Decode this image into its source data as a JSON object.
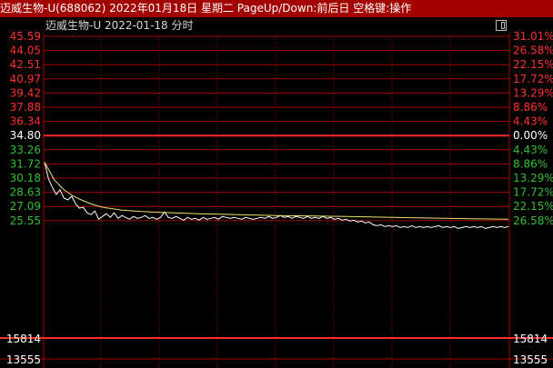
{
  "title_bar": {
    "text": "迈威生物-U(688062) 2022年01月18日 星期二 PageUp/Down:前后日 空格键:操作"
  },
  "chart_header": {
    "text": "迈威生物-U  2022-01-18 分时"
  },
  "colors": {
    "background": "#000000",
    "grid": "#a30000",
    "baseline": "#ff2a2a",
    "up_text": "#ff3030",
    "down_text": "#30c030",
    "neutral_text": "#ffffff",
    "price_line": "#ffffff",
    "avg_line": "#f0e070",
    "title_bar": "#a30000"
  },
  "icons": {
    "maximize": "maximize-icon"
  },
  "chart_data": {
    "type": "line",
    "title": "迈威生物-U  2022-01-18 分时",
    "prev_close": 34.8,
    "ylim": [
      25.55,
      45.59
    ],
    "y_ticks_left": [
      "45.59",
      "44.05",
      "42.51",
      "40.97",
      "39.42",
      "37.88",
      "36.34",
      "34.80",
      "33.26",
      "31.72",
      "30.18",
      "28.63",
      "27.09",
      "25.55"
    ],
    "y_ticks_right": [
      "31.01%",
      "26.58%",
      "22.15%",
      "17.72%",
      "13.29%",
      "8.86%",
      "4.43%",
      "0.00%",
      "4.43%",
      "8.86%",
      "13.29%",
      "17.72%",
      "22.15%",
      "26.58%"
    ],
    "volume_ticks_left": [
      "15814",
      "13555"
    ],
    "volume_ticks_right": [
      "15814",
      "13555"
    ],
    "grid": true,
    "x_minutes": 240,
    "series": [
      {
        "kind": "price",
        "points": [
          [
            0,
            31.9
          ],
          [
            2,
            30.1
          ],
          [
            4,
            29.2
          ],
          [
            6,
            28.4
          ],
          [
            8,
            28.9
          ],
          [
            10,
            28.0
          ],
          [
            12,
            27.8
          ],
          [
            14,
            28.2
          ],
          [
            16,
            27.4
          ],
          [
            18,
            26.9
          ],
          [
            20,
            27.0
          ],
          [
            22,
            26.4
          ],
          [
            24,
            26.2
          ],
          [
            26,
            26.6
          ],
          [
            28,
            25.7
          ],
          [
            30,
            26.0
          ],
          [
            32,
            26.3
          ],
          [
            34,
            25.9
          ],
          [
            36,
            26.4
          ],
          [
            38,
            25.8
          ],
          [
            40,
            26.1
          ],
          [
            42,
            25.9
          ],
          [
            44,
            25.7
          ],
          [
            46,
            26.0
          ],
          [
            48,
            25.8
          ],
          [
            50,
            25.9
          ],
          [
            52,
            26.1
          ],
          [
            54,
            25.8
          ],
          [
            56,
            25.9
          ],
          [
            58,
            25.7
          ],
          [
            60,
            25.9
          ],
          [
            62,
            26.5
          ],
          [
            64,
            25.9
          ],
          [
            66,
            25.8
          ],
          [
            68,
            26.0
          ],
          [
            70,
            25.8
          ],
          [
            72,
            25.6
          ],
          [
            74,
            25.9
          ],
          [
            76,
            25.7
          ],
          [
            78,
            25.8
          ],
          [
            80,
            25.6
          ],
          [
            82,
            25.9
          ],
          [
            84,
            25.7
          ],
          [
            86,
            25.8
          ],
          [
            88,
            25.9
          ],
          [
            90,
            25.7
          ],
          [
            92,
            26.0
          ],
          [
            94,
            25.9
          ],
          [
            96,
            25.8
          ],
          [
            98,
            25.9
          ],
          [
            100,
            25.8
          ],
          [
            102,
            25.7
          ],
          [
            104,
            25.9
          ],
          [
            106,
            25.8
          ],
          [
            108,
            25.7
          ],
          [
            110,
            25.8
          ],
          [
            112,
            25.9
          ],
          [
            114,
            25.8
          ],
          [
            116,
            26.0
          ],
          [
            118,
            25.8
          ],
          [
            120,
            25.9
          ],
          [
            122,
            26.1
          ],
          [
            124,
            25.9
          ],
          [
            126,
            26.0
          ],
          [
            128,
            25.8
          ],
          [
            130,
            26.0
          ],
          [
            132,
            25.9
          ],
          [
            134,
            25.8
          ],
          [
            136,
            26.0
          ],
          [
            138,
            25.8
          ],
          [
            140,
            25.9
          ],
          [
            142,
            25.8
          ],
          [
            144,
            26.0
          ],
          [
            146,
            25.8
          ],
          [
            148,
            25.9
          ],
          [
            150,
            25.7
          ],
          [
            152,
            25.8
          ],
          [
            154,
            25.6
          ],
          [
            156,
            25.7
          ],
          [
            158,
            25.5
          ],
          [
            160,
            25.6
          ],
          [
            162,
            25.4
          ],
          [
            164,
            25.5
          ],
          [
            166,
            25.3
          ],
          [
            168,
            25.4
          ],
          [
            170,
            25.1
          ],
          [
            172,
            25.0
          ],
          [
            174,
            25.1
          ],
          [
            176,
            24.9
          ],
          [
            178,
            25.0
          ],
          [
            180,
            24.9
          ],
          [
            182,
            25.0
          ],
          [
            184,
            24.8
          ],
          [
            186,
            24.9
          ],
          [
            188,
            24.8
          ],
          [
            190,
            25.0
          ],
          [
            192,
            24.8
          ],
          [
            194,
            24.9
          ],
          [
            196,
            24.8
          ],
          [
            198,
            24.9
          ],
          [
            200,
            24.8
          ],
          [
            202,
            24.9
          ],
          [
            204,
            25.0
          ],
          [
            206,
            24.8
          ],
          [
            208,
            24.9
          ],
          [
            210,
            24.8
          ],
          [
            212,
            24.9
          ],
          [
            214,
            24.7
          ],
          [
            216,
            24.8
          ],
          [
            218,
            24.9
          ],
          [
            220,
            24.8
          ],
          [
            222,
            24.9
          ],
          [
            224,
            24.8
          ],
          [
            226,
            24.9
          ],
          [
            228,
            24.7
          ],
          [
            230,
            24.8
          ],
          [
            232,
            24.9
          ],
          [
            234,
            24.8
          ],
          [
            236,
            24.9
          ],
          [
            238,
            24.8
          ],
          [
            240,
            24.9
          ]
        ]
      },
      {
        "kind": "average",
        "points": [
          [
            0,
            31.9
          ],
          [
            5,
            30.0
          ],
          [
            10,
            28.9
          ],
          [
            15,
            28.2
          ],
          [
            20,
            27.7
          ],
          [
            25,
            27.3
          ],
          [
            30,
            27.0
          ],
          [
            40,
            26.7
          ],
          [
            50,
            26.55
          ],
          [
            60,
            26.45
          ],
          [
            80,
            26.3
          ],
          [
            100,
            26.2
          ],
          [
            120,
            26.1
          ],
          [
            140,
            26.05
          ],
          [
            160,
            25.98
          ],
          [
            180,
            25.9
          ],
          [
            200,
            25.83
          ],
          [
            220,
            25.76
          ],
          [
            240,
            25.7
          ]
        ]
      }
    ]
  }
}
